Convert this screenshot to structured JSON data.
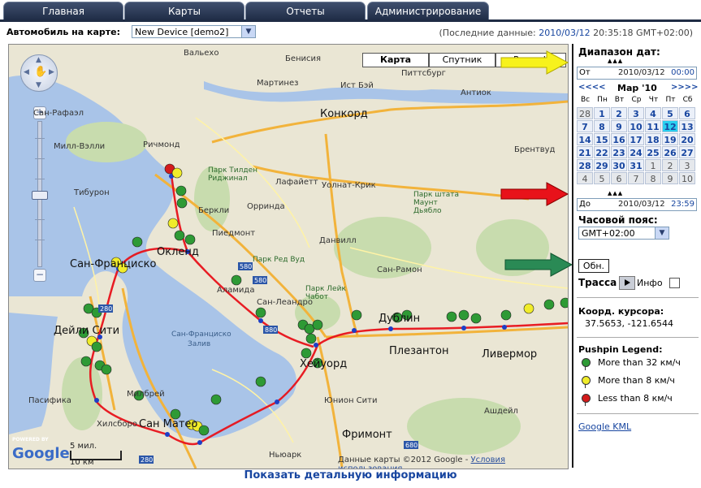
{
  "tabs": [
    {
      "label": "Главная"
    },
    {
      "label": "Карты"
    },
    {
      "label": "Отчеты"
    },
    {
      "label": "Администрирование"
    }
  ],
  "toolbar": {
    "car_label": "Автомобиль на карте:",
    "car_value": "New Device [demo2]",
    "last_prefix": "(Последние данные:",
    "last_date": "2010/03/12",
    "last_rest": "20:35:18 GMT+02:00)"
  },
  "map": {
    "types": [
      {
        "label": "Карта"
      },
      {
        "label": "Спутник"
      },
      {
        "label": "Рельеф"
      }
    ],
    "zoom": {
      "plus": "+",
      "minus": "−"
    },
    "places": [
      {
        "t": "Сан-Рафаэл",
        "c": "mid"
      },
      {
        "t": "Ричмонд",
        "c": "mid"
      },
      {
        "t": "Беркли",
        "c": "mid"
      },
      {
        "t": "Окленд",
        "c": "big"
      },
      {
        "t": "Сан-Франциско",
        "c": "big"
      },
      {
        "t": "Аламида",
        "c": "mid"
      },
      {
        "t": "Дейли Сити",
        "c": "big"
      },
      {
        "t": "Сан-Леандро",
        "c": "mid"
      },
      {
        "t": "Хейуорд",
        "c": "big"
      },
      {
        "t": "Плезантон",
        "c": "big"
      },
      {
        "t": "Ливермор",
        "c": "big"
      },
      {
        "t": "Фримонт",
        "c": "big"
      },
      {
        "t": "Юнион Сити",
        "c": "mid"
      },
      {
        "t": "Сан Матео",
        "c": "big"
      },
      {
        "t": "Конкорд",
        "c": "big"
      },
      {
        "t": "Уолнат-Крик",
        "c": "mid"
      },
      {
        "t": "Данвилл",
        "c": "mid"
      },
      {
        "t": "Сан-Рамон",
        "c": "mid"
      },
      {
        "t": "Лафайетт",
        "c": "mid"
      },
      {
        "t": "Орринда",
        "c": "mid"
      },
      {
        "t": "Антиок",
        "c": "mid"
      },
      {
        "t": "Питтсбург",
        "c": "mid"
      },
      {
        "t": "Мартинез",
        "c": "mid"
      },
      {
        "t": "Бенисия",
        "c": "mid"
      },
      {
        "t": "Вальехо",
        "c": "mid"
      },
      {
        "t": "Пасифика",
        "c": "mid"
      },
      {
        "t": "Хилсборо",
        "c": "mid"
      },
      {
        "t": "Брентвуд",
        "c": "mid"
      },
      {
        "t": "Тибурон",
        "c": "mid"
      },
      {
        "t": "Милл-Вэлли",
        "c": "mid"
      },
      {
        "t": "Ньюарк",
        "c": "mid"
      },
      {
        "t": "Пиедмонт",
        "c": "mid"
      },
      {
        "t": "Сан-Франциско",
        "c": "water"
      },
      {
        "t": "Залив",
        "c": "water"
      },
      {
        "t": "Парк штата Маунт Дьябло",
        "c": "park"
      },
      {
        "t": "Парк Ред Вуд",
        "c": "park"
      },
      {
        "t": "Парк Тилден Риджинал",
        "c": "park"
      },
      {
        "t": "Парк Лейк Чабот",
        "c": "park"
      },
      {
        "t": "Дублин",
        "c": "big"
      },
      {
        "t": "Ист Бэй",
        "c": "mid"
      },
      {
        "t": "Ашдейл",
        "c": "mid"
      },
      {
        "t": "Милбрей",
        "c": "mid"
      }
    ],
    "scale": {
      "top": "5 мил.",
      "bottom": "10 км"
    },
    "google": "Google",
    "powered": "POWERED BY",
    "copyright_text": "Данные карты ©2012 Google -",
    "copyright_link": "Условия использования"
  },
  "sidebar": {
    "date_range_title": "Диапазон дат:",
    "arrows_up": "▲▲▲",
    "from": {
      "label": "От",
      "date": "2010/03/12",
      "time": "00:00"
    },
    "calendar": {
      "prev": "<<<<",
      "next": ">>>>",
      "month": "Мар '10",
      "dows": [
        "Вс",
        "Пн",
        "Вт",
        "Ср",
        "Чт",
        "Пт",
        "Сб"
      ],
      "weeks": [
        [
          "28",
          "1",
          "2",
          "3",
          "4",
          "5",
          "6"
        ],
        [
          "7",
          "8",
          "9",
          "10",
          "11",
          "12",
          "13"
        ],
        [
          "14",
          "15",
          "16",
          "17",
          "18",
          "19",
          "20"
        ],
        [
          "21",
          "22",
          "23",
          "24",
          "25",
          "26",
          "27"
        ],
        [
          "28",
          "29",
          "30",
          "31",
          "1",
          "2",
          "3"
        ],
        [
          "4",
          "5",
          "6",
          "7",
          "8",
          "9",
          "10"
        ]
      ]
    },
    "to": {
      "label": "До",
      "date": "2010/03/12",
      "time": "23:59"
    },
    "tz_label": "Часовой пояс:",
    "tz_value": "GMT+02:00",
    "refresh": "Обн.",
    "track_label": "Трасса",
    "info_label": "Инфо",
    "coord_label": "Коорд. курсора:",
    "coord_value": "37.5653, -121.6544",
    "legend_title": "Pushpin Legend:",
    "legend": [
      {
        "label": "More than 32 км/ч",
        "color": "#2e9a35"
      },
      {
        "label": "More than 8 км/ч",
        "color": "#f0ec2a"
      },
      {
        "label": "Less than 8 км/ч",
        "color": "#d41b1b"
      }
    ],
    "kml": "Google KML"
  },
  "bottom_link": "Показать детальную информацию",
  "colors": {
    "tab_bg": "#1f2c45",
    "link": "#1846a0",
    "route": "#e8121a",
    "selected_day": "#2ad0f0"
  }
}
